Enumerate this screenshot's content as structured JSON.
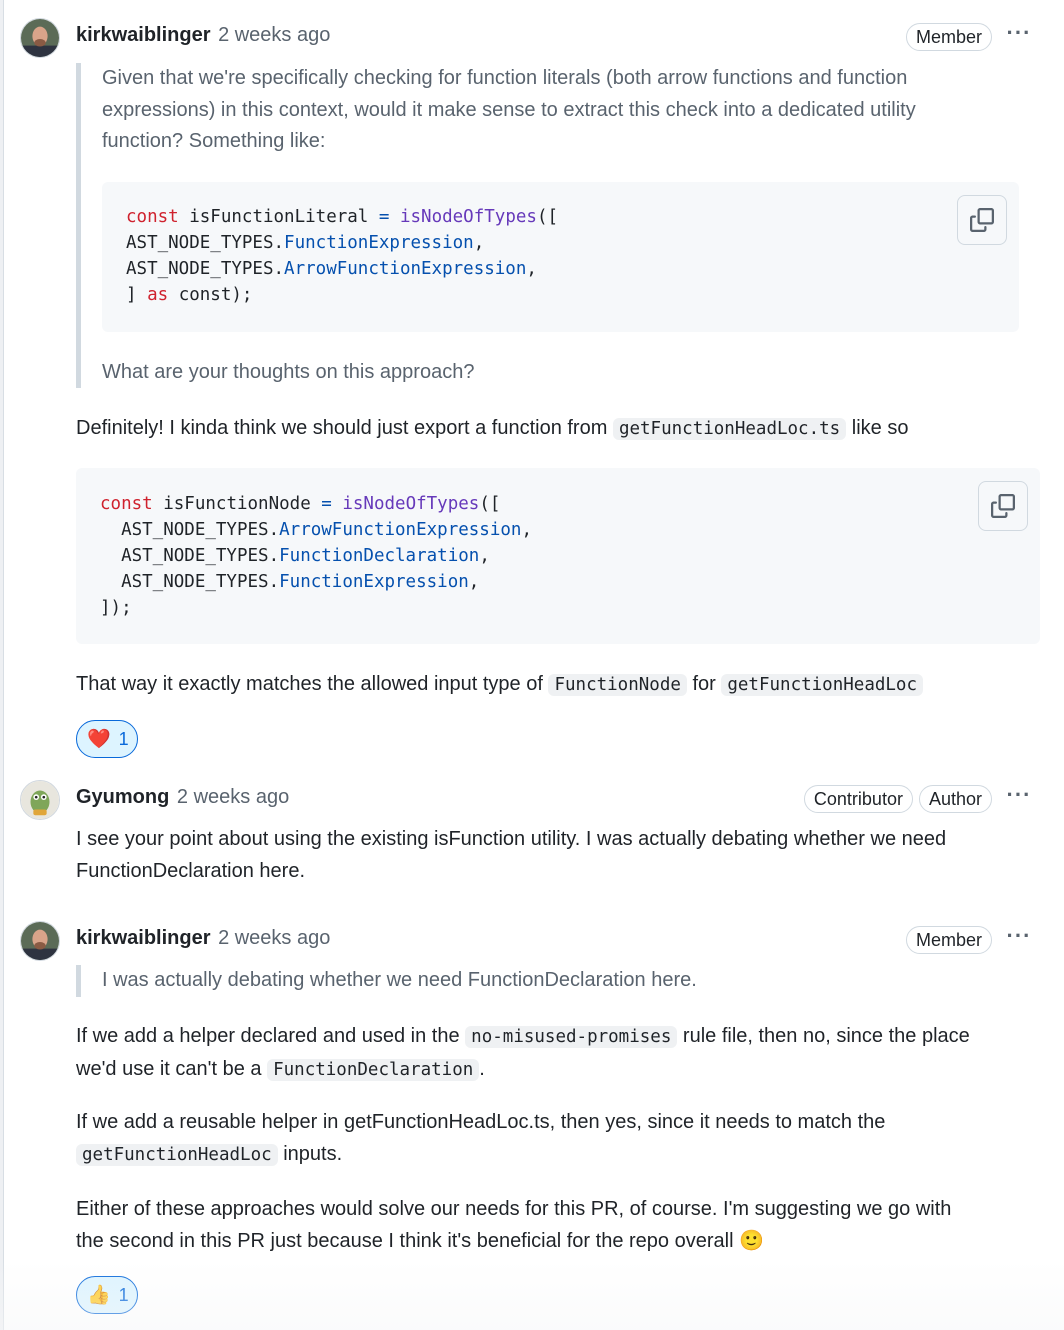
{
  "comments": [
    {
      "author": "kirkwaiblinger",
      "time": "2 weeks ago",
      "badges": [
        "Member"
      ],
      "quote_lines": [
        "Given that we're specifically checking for function literals (both arrow functions and function",
        "expressions) in this context, would it make sense to extract this check into a dedicated utility",
        "function? Something like:"
      ],
      "quote_code": {
        "l1_kw": "const",
        "l1_name": " isFunctionLiteral ",
        "l1_eq": "=",
        "l1_fn": " isNodeOfTypes",
        "l1_end": "([",
        "l2_a": "AST_NODE_TYPES.",
        "l2_b": "FunctionExpression",
        "l2_c": ",",
        "l3_a": "AST_NODE_TYPES.",
        "l3_b": "ArrowFunctionExpression",
        "l3_c": ",",
        "l4_a": "] ",
        "l4_kw": "as",
        "l4_c": " const);"
      },
      "quote_tail": "What are your thoughts on this approach?",
      "reply_pre": "Definitely! I kinda think we should just export a function from ",
      "reply_code": "getFunctionHeadLoc.ts",
      "reply_post": " like so",
      "code": {
        "l1_kw": "const",
        "l1_name": " isFunctionNode ",
        "l1_eq": "=",
        "l1_fn": " isNodeOfTypes",
        "l1_end": "([",
        "l2_a": "  AST_NODE_TYPES.",
        "l2_b": "ArrowFunctionExpression",
        "l2_c": ",",
        "l3_a": "  AST_NODE_TYPES.",
        "l3_b": "FunctionDeclaration",
        "l3_c": ",",
        "l4_a": "  AST_NODE_TYPES.",
        "l4_b": "FunctionExpression",
        "l4_c": ",",
        "l5": "]);"
      },
      "tail_pre": "That way it exactly matches the allowed input type of ",
      "tail_code1": "FunctionNode",
      "tail_mid": " for ",
      "tail_code2": "getFunctionHeadLoc",
      "reaction": {
        "emoji": "❤️",
        "count": "1"
      }
    },
    {
      "author": "Gyumong",
      "time": "2 weeks ago",
      "badges": [
        "Contributor",
        "Author"
      ],
      "body_lines": [
        "I see your point about using the existing isFunction utility. I was actually debating whether we need",
        "FunctionDeclaration here."
      ]
    },
    {
      "author": "kirkwaiblinger",
      "time": "2 weeks ago",
      "badges": [
        "Member"
      ],
      "quote": "I was actually debating whether we need FunctionDeclaration here.",
      "p1_pre": "If we add a helper declared and used in the ",
      "p1_code": "no-misused-promises",
      "p1_post": " rule file, then no, since the place",
      "p1_l2_pre": "we'd use it can't be a ",
      "p1_l2_code": "FunctionDeclaration",
      "p1_l2_post": ".",
      "p2_l1": "If we add a reusable helper in getFunctionHeadLoc.ts, then yes, since it needs to match the",
      "p2_code": "getFunctionHeadLoc",
      "p2_post": " inputs.",
      "p3_l1": "Either of these approaches would solve our needs for this PR, of course. I'm suggesting we go with",
      "p3_l2": "the second in this PR just because I think it's beneficial for the repo overall ",
      "p3_emoji": "🙂",
      "reaction": {
        "emoji": "👍",
        "count": "1"
      }
    }
  ],
  "icons": {
    "kebab": "kebab-horizontal-icon",
    "copy": "copy-icon",
    "kebab_glyph": "···"
  }
}
